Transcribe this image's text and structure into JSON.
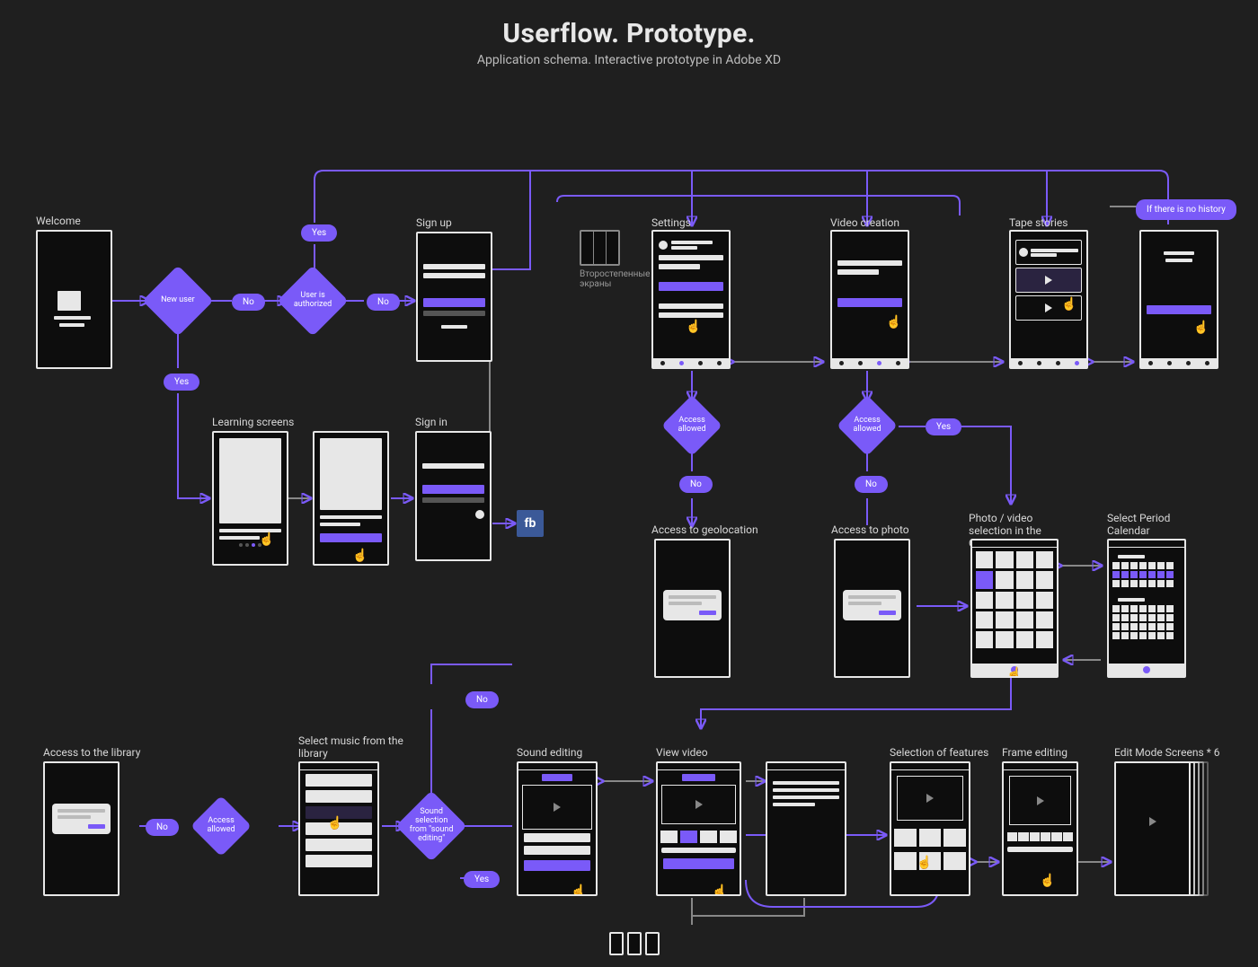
{
  "header": {
    "title": "Userflow. Prototype.",
    "subtitle": "Application schema. Interactive prototype in Adobe XD"
  },
  "screens": {
    "welcome": "Welcome",
    "signup": "Sign up",
    "signin": "Sign in",
    "learning": "Learning screens",
    "settings": "Settings",
    "settings_aside": "Второстепенные экраны",
    "video_creation": "Video creation",
    "tape_stories": "Tape stories",
    "no_history": "If there is no history",
    "access_geo": "Access to geolocation",
    "access_photo": "Access to photo",
    "gallery": "Photo / video selection in the Gallery",
    "calendar": "Select Period Calendar",
    "access_lib": "Access to the library",
    "select_music": "Select music from the library",
    "sound_editing": "Sound editing",
    "view_video": "View video",
    "features": "Selection of features",
    "frame_editing": "Frame editing",
    "edit_mode": "Edit Mode Screens * 6"
  },
  "decisions": {
    "new_user": "New user",
    "user_authorized": "User is authorized",
    "access_allowed_1": "Access allowed",
    "access_allowed_2": "Access allowed",
    "access_allowed_3": "Access allowed",
    "sound_selection": "Sound selection from \"sound editing\""
  },
  "pills": {
    "yes": "Yes",
    "no": "No"
  },
  "fb": "fb",
  "colors": {
    "accent": "#7a5af8",
    "bg": "#1f1f1f",
    "border": "#e7e7e7"
  }
}
